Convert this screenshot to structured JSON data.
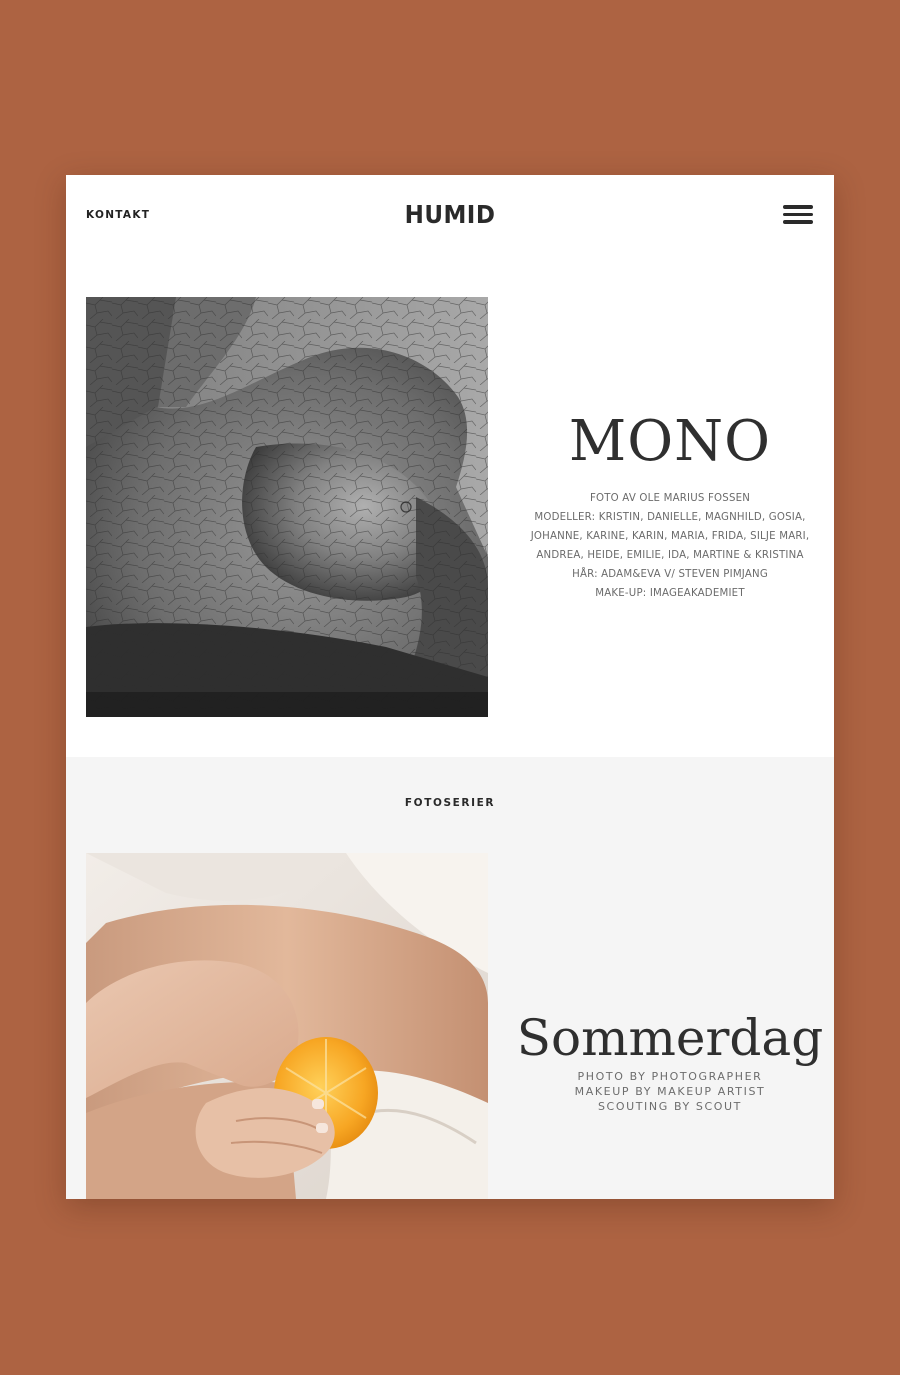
{
  "colors": {
    "background": "#ad6342",
    "card": "#ffffff",
    "section_alt": "#f5f5f5",
    "text_dark": "#2a2a2a",
    "text_muted": "#6b6b6b"
  },
  "header": {
    "contact_label": "KONTAKT",
    "logo": "HUMID",
    "menu_icon": "hamburger-menu-icon"
  },
  "feature": {
    "image_alt": "Black and white close-up of a body covered in cracked clay",
    "title": "MONO",
    "credits": [
      "FOTO AV OLE MARIUS FOSSEN",
      "MODELLER: KRISTIN, DANIELLE, MAGNHILD, GOSIA,",
      "JOHANNE, KARINE, KARIN, MARIA, FRIDA, SILJE MARI,",
      "ANDREA, HEIDE, EMILIE, IDA, MARTINE & KRISTINA",
      "HÅR: ADAM&EVA V/ STEVEN PIMJANG",
      "MAKE-UP: IMAGEAKADEMIET"
    ]
  },
  "series": {
    "section_label": "FOTOSERIER",
    "items": [
      {
        "image_alt": "Hands peeling an orange on a lap with white linen",
        "title": "Sommerdag",
        "credits": [
          "PHOTO BY PHOTOGRAPHER",
          "MAKEUP BY MAKEUP ARTIST",
          "SCOUTING BY SCOUT"
        ]
      }
    ]
  }
}
